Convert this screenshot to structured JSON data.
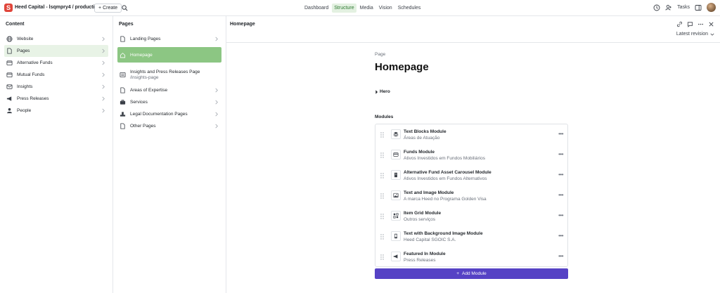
{
  "topbar": {
    "logo_letter": "S",
    "workspace": "Heed Capital - lsqmpry4 / production",
    "create_label": "Create",
    "nav": [
      {
        "label": "Dashboard",
        "active": false
      },
      {
        "label": "Structure",
        "active": true
      },
      {
        "label": "Media",
        "active": false
      },
      {
        "label": "Vision",
        "active": false
      },
      {
        "label": "Schedules",
        "active": false
      }
    ],
    "tasks_label": "Tasks"
  },
  "content_pane": {
    "title": "Content",
    "items": [
      {
        "label": "Website",
        "icon": "globe-icon"
      },
      {
        "label": "Pages",
        "icon": "document-icon",
        "selected": true
      },
      {
        "label": "Alternative Funds",
        "icon": "wallet-icon"
      },
      {
        "label": "Mutual Funds",
        "icon": "wallet-icon"
      },
      {
        "label": "Insights",
        "icon": "envelope-icon"
      },
      {
        "label": "Press Releases",
        "icon": "megaphone-icon"
      },
      {
        "label": "People",
        "icon": "user-icon"
      }
    ]
  },
  "pages_pane": {
    "title": "Pages",
    "items": [
      {
        "label": "Landing Pages",
        "icon": "document-icon",
        "chevron": true
      },
      {
        "label": "Homepage",
        "icon": "home-icon",
        "selected": true
      },
      {
        "label": "Insights and Press Releases Page",
        "sub": "/insights-page",
        "icon": "list-icon"
      },
      {
        "label": "Areas of Expertise",
        "icon": "document-icon",
        "chevron": true
      },
      {
        "label": "Services",
        "icon": "briefcase-icon",
        "chevron": true
      },
      {
        "label": "Legal Documentation Pages",
        "icon": "stamp-icon",
        "chevron": true
      },
      {
        "label": "Other Pages",
        "icon": "document-icon",
        "chevron": true
      }
    ]
  },
  "document": {
    "pane_title": "Homepage",
    "revision_label": "Latest revision",
    "kind": "Page",
    "title": "Homepage",
    "hero_label": "Hero",
    "modules_label": "Modules",
    "modules": [
      {
        "name": "Text Blocks Module",
        "sub": "Áreas de Atuação",
        "icon": "layers-icon"
      },
      {
        "name": "Funds Module",
        "sub": "Ativos Investidos em Fundos Mobiliários",
        "icon": "card-icon"
      },
      {
        "name": "Alternative Fund Asset Carousel Module",
        "sub": "Ativos Investidos em Fundos Alternativos",
        "icon": "building-icon"
      },
      {
        "name": "Text and Image Module",
        "sub": "A marca Heed no Programa Golden Visa",
        "icon": "image-icon"
      },
      {
        "name": "Item Grid Module",
        "sub": "Outros serviços",
        "icon": "grid-icon"
      },
      {
        "name": "Text with Background Image Module",
        "sub": "Heed Capital SGOIC S.A.",
        "icon": "phone-icon"
      },
      {
        "name": "Featured In Module",
        "sub": "Press Releases",
        "icon": "megaphone-icon"
      }
    ],
    "add_module_label": "Add Module"
  },
  "colors": {
    "brand": "#e0453a",
    "nav_active_bg": "#e3f1e1",
    "selected_strong": "#8cc683",
    "selected_light": "#e8f3e6",
    "primary_button": "#5642c5"
  }
}
